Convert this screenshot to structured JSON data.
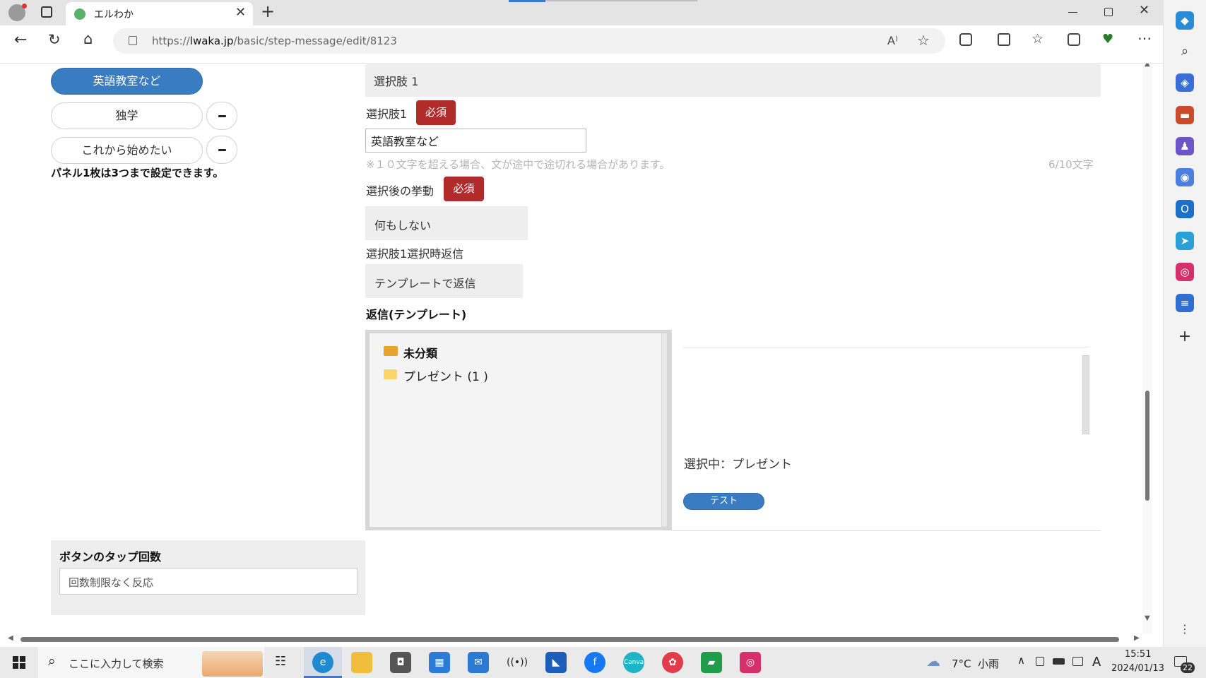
{
  "browser": {
    "tab_title": "エルわか",
    "url_prefix": "https://",
    "url_domain": "lwaka.jp",
    "url_path": "/basic/step-message/edit/8123"
  },
  "left_panel": {
    "selected_choice": "英語教室など",
    "choices": [
      "独学",
      "これから始めたい"
    ],
    "note": "パネル1枚は3つまで設定できます。"
  },
  "choice_form": {
    "header": "選択肢 1",
    "choice_label": "選択肢1",
    "required_badge": "必須",
    "choice_value": "英語教室など",
    "hint": "※１０文字を超える場合、文が途中で途切れる場合があります。",
    "char_count": "6/10文字",
    "action_label": "選択後の挙動",
    "action_value": "何もしない",
    "reply_label": "選択肢1選択時返信",
    "reply_value": "テンプレートで返信",
    "template_heading": "返信(テンプレート)",
    "folders": [
      {
        "name": "未分類",
        "open": true
      },
      {
        "name": "プレゼント (1 )",
        "open": false
      }
    ],
    "selected_text": "選択中：プレゼント",
    "test_button": "テスト"
  },
  "tap_count": {
    "heading": "ボタンのタップ回数",
    "value": "回数制限なく反応"
  },
  "taskbar": {
    "search_placeholder": "ここに入力して検索",
    "weather": "7°C  小雨",
    "ime": "A",
    "time": "15:51",
    "date": "2024/01/13",
    "notifications": "22"
  },
  "colors": {
    "accent_blue": "#3a7cc1",
    "required_red": "#b22b2b",
    "panel_grey": "#eeeeee"
  }
}
